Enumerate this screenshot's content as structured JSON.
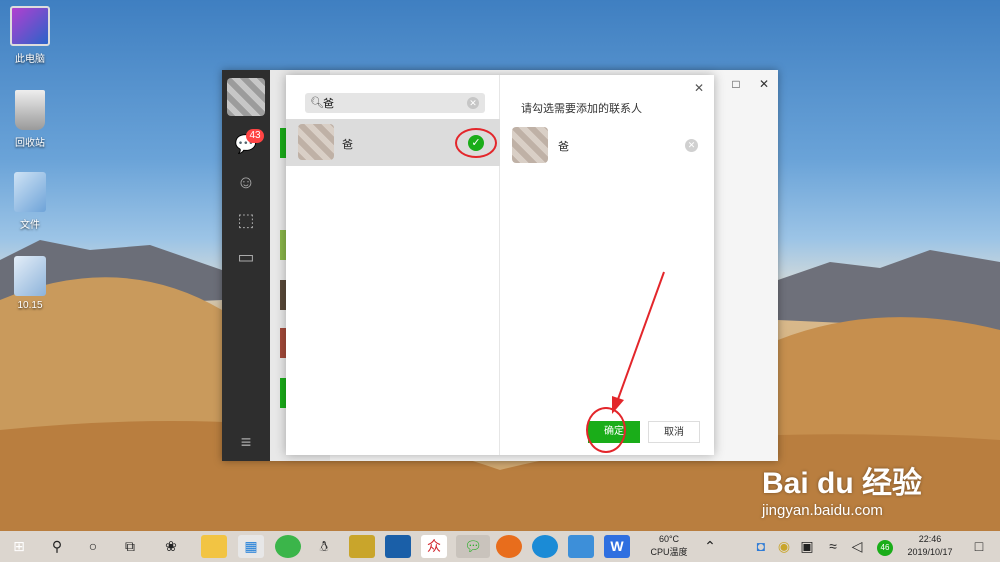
{
  "desktop": {
    "icons": [
      {
        "label": "此电脑"
      },
      {
        "label": "回收站"
      },
      {
        "label": "文件"
      },
      {
        "label": "10.15"
      }
    ]
  },
  "wechat": {
    "unread_badge": "43"
  },
  "dialog": {
    "search": {
      "value": "爸"
    },
    "result": {
      "name": "爸"
    },
    "right_title": "请勾选需要添加的联系人",
    "selected": {
      "name": "爸"
    },
    "ok_label": "确定",
    "cancel_label": "取消"
  },
  "watermark": {
    "brand": "Bai du 经验",
    "url": "jingyan.baidu.com"
  },
  "taskbar": {
    "temp": "60°C",
    "temp_label": "CPU温度",
    "tray_badge": "46",
    "time": "22:46",
    "date": "2019/10/17"
  }
}
